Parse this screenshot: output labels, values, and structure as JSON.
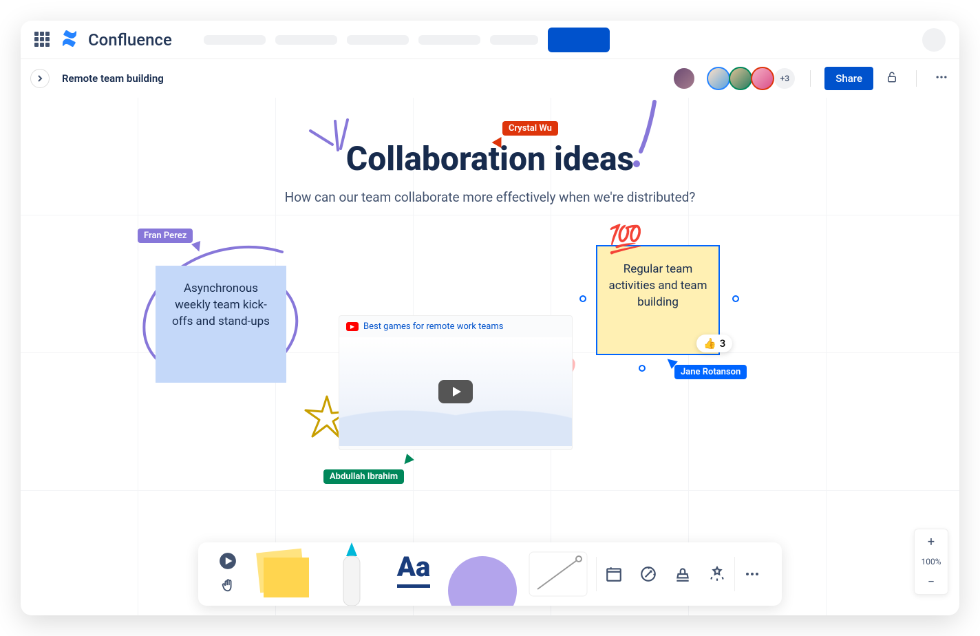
{
  "brand": "Confluence",
  "breadcrumb": "Remote team building",
  "share_label": "Share",
  "presence_more": "+3",
  "title": "Collaboration ideas",
  "subtitle": "How can our team collaborate more effectively when we're distributed?",
  "cursors": {
    "crystal": "Crystal Wu",
    "fran": "Fran Perez",
    "abdullah": "Abdullah Ibrahim",
    "jane": "Jane Rotanson"
  },
  "stickies": {
    "blue": "Asynchronous weekly team kick-offs and stand-ups",
    "yellow": "Regular team activities and team building"
  },
  "reaction": {
    "emoji": "👍",
    "count": "3"
  },
  "hundred_emoji": "💯",
  "video": {
    "title": "Best games for remote work teams"
  },
  "toolbar": {
    "text_label": "Aa"
  },
  "zoom": {
    "level": "100%"
  }
}
